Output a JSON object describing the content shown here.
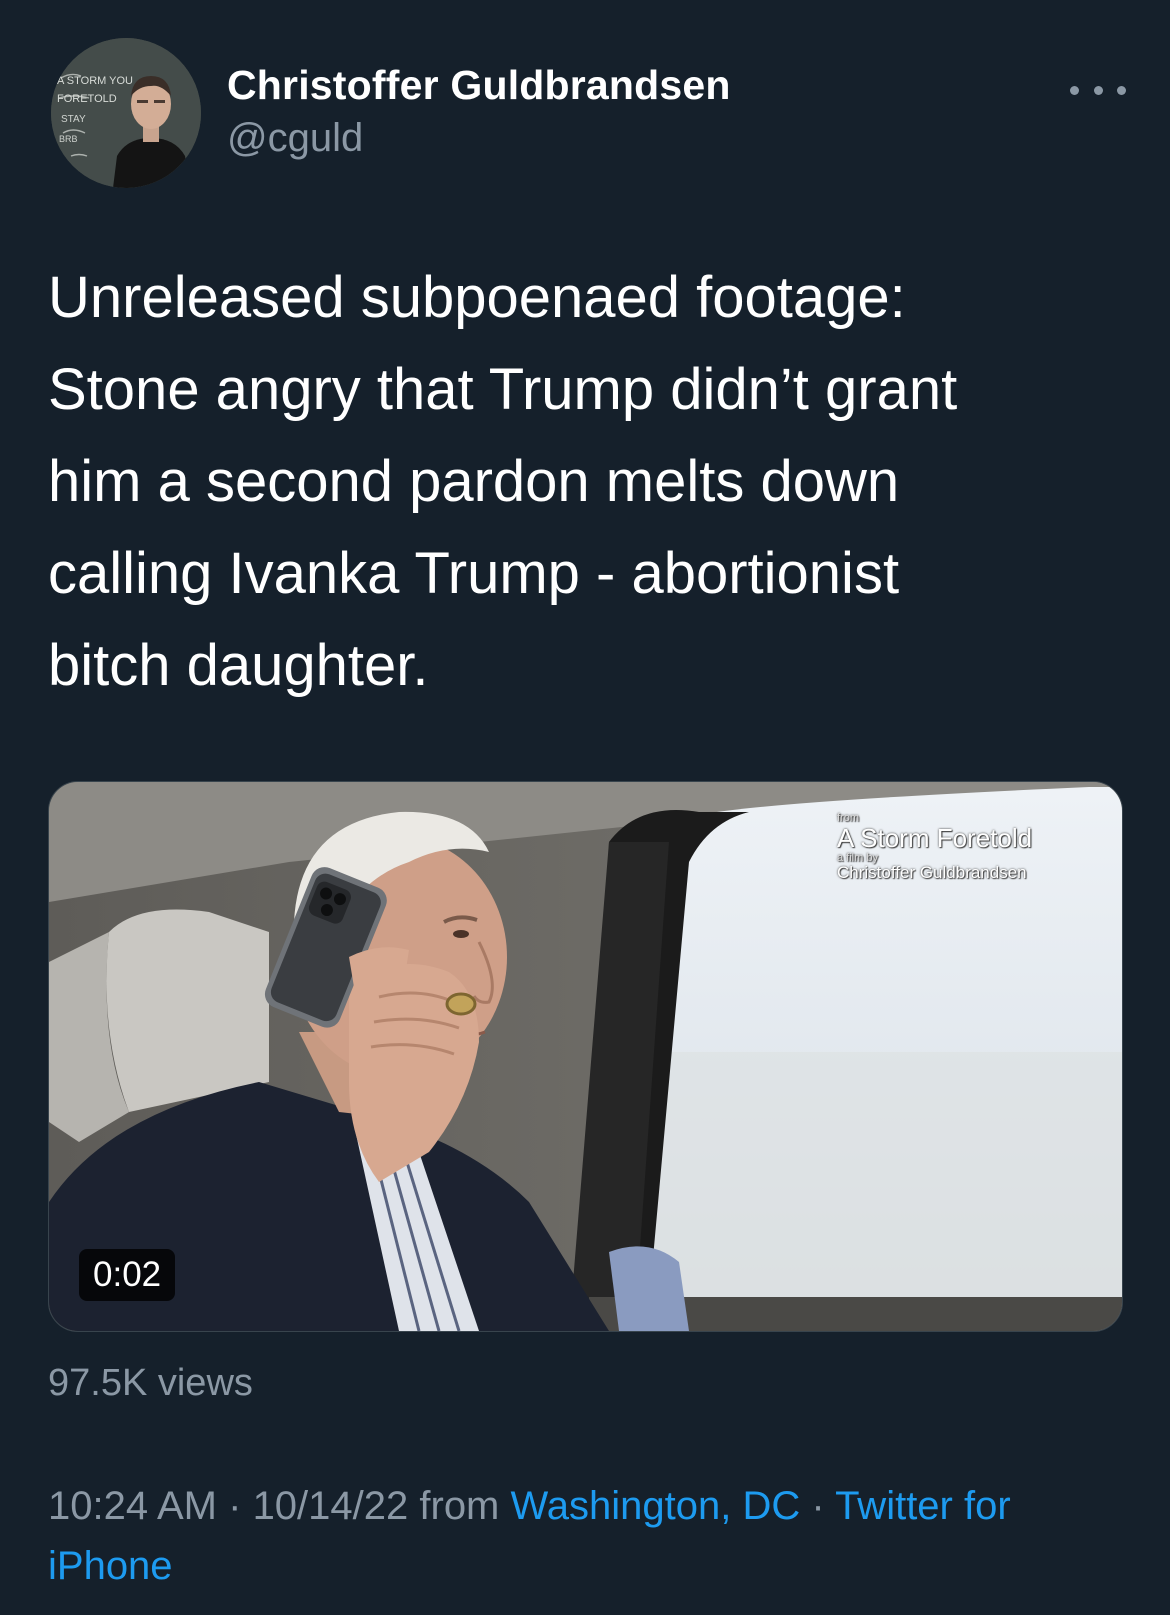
{
  "author": {
    "name": "Christoffer Guldbrandsen",
    "handle": "@cguld",
    "avatar_chalk_text": [
      "A STORM YOU",
      "FORETOLD",
      "STAY",
      "BRB"
    ]
  },
  "tweet": {
    "text_lines": [
      "Unreleased subpoenaed footage:",
      "Stone angry that Trump didn’t grant",
      "him a second pardon melts down",
      "calling Ivanka Trump - abortionist",
      "bitch daughter."
    ]
  },
  "media": {
    "type": "video",
    "duration": "0:02",
    "watermark": {
      "from": "from",
      "title": "A Storm Foretold",
      "byline": "a film by",
      "author": "Christoffer Guldbrandsen"
    }
  },
  "stats": {
    "views": "97.5K views"
  },
  "meta": {
    "time": "10:24 AM",
    "separator": " · ",
    "date": "10/14/22",
    "from_word": " from ",
    "location": "Washington, DC",
    "source": "Twitter for iPhone"
  },
  "colors": {
    "background": "#15202b",
    "secondary_text": "#8b98a5",
    "link": "#1d9bf0"
  },
  "icons": {
    "more": "more-horizontal-icon",
    "avatar": "avatar-image"
  }
}
